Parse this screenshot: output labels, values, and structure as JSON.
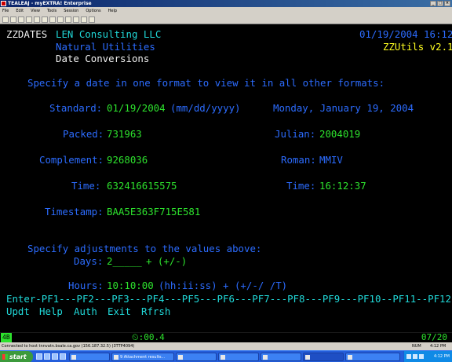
{
  "window": {
    "title": "TEALEAJ - myEXTRA! Enterprise",
    "menu": [
      "File",
      "Edit",
      "View",
      "Tools",
      "Session",
      "Options",
      "Help"
    ]
  },
  "screen": {
    "program_id": "ZZDATES",
    "company": "LEN Consulting LLC",
    "datetime": "01/19/2004 16:12",
    "subtitle": "Natural Utilities",
    "product": "ZZUtils v2.1",
    "screen_title": "Date Conversions",
    "instruction": "Specify a date in one format to view it in all other formats:",
    "fields": {
      "standard_label": "Standard:",
      "standard_value": "01/19/2004",
      "standard_hint": "(mm/dd/yyyy)",
      "long_date": "Monday, January 19, 2004",
      "packed_label": "Packed:",
      "packed_value": "731963",
      "julian_label": "Julian:",
      "julian_value": "2004019",
      "complement_label": "Complement:",
      "complement_value": "9268036",
      "roman_label": "Roman:",
      "roman_value": "MMIV",
      "time_label": "Time:",
      "time_value": "632416615575",
      "time2_label": "Time:",
      "time2_value": "16:12:37",
      "timestamp_label": "Timestamp:",
      "timestamp_value": "BAA5E363F715E581"
    },
    "adjust": {
      "instruction": "Specify adjustments to the values above:",
      "days_label": "Days:",
      "days_value": "2_____",
      "days_hint": "+ (+/-)",
      "hours_label": "Hours:",
      "hours_value": "10:10:00",
      "hours_hint": "(hh:ii:ss) + (+/-/ /T)"
    },
    "pf_line": "Enter-PF1---PF2---PF3---PF4---PF5---PF6---PF7---PF8---PF9---PF10--PF11--PF12---",
    "pf_keys": [
      "Updt",
      "Help",
      "Auth",
      "Exit",
      "Rfrsh"
    ]
  },
  "status": {
    "mode": "4B",
    "elapsed": ":00.4",
    "cursor": "07/20"
  },
  "infobar": {
    "connection": "Connected to host tnnvatn.bsale.ca.gov (156.187.32.5) (3TTP4094)",
    "num": "NUM",
    "time": "4:12 PM"
  },
  "taskbar": {
    "start": "start",
    "items": [
      "9 Attachment results...",
      "",
      "",
      "",
      "",
      ""
    ],
    "clock": "4:12 PM"
  }
}
